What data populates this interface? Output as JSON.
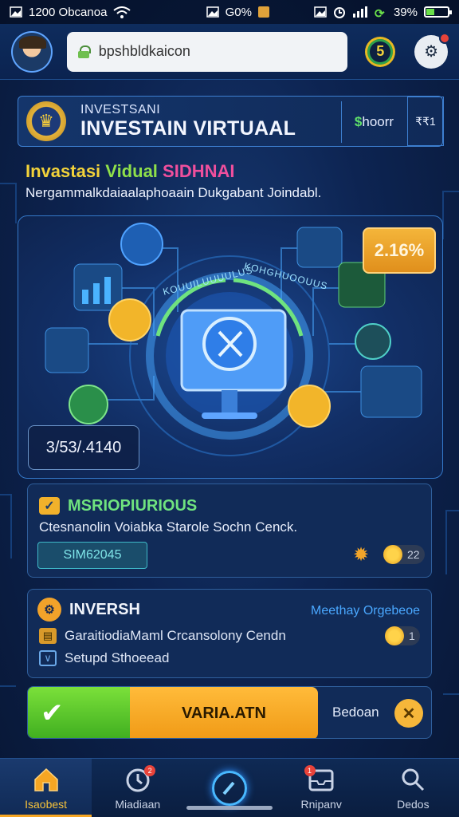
{
  "status_bar": {
    "time": "1200 Obcanoa",
    "battery": "39%",
    "battery_level": 0.39,
    "signal_text": "G0%",
    "icons": [
      "image-icon",
      "wifi-icon",
      "image-icon",
      "alarm-icon",
      "signal-icon",
      "data-icon",
      "battery-icon"
    ]
  },
  "top_bar": {
    "url": "bpshbldkaicon",
    "coin_value": "5",
    "avatar": "avatar-icon"
  },
  "header": {
    "subtitle": "INVESTSANI",
    "title": "INVESTAIN VIRTUAAL",
    "balance_symbol": "$",
    "balance_text": "hoorr",
    "count": "₹₹1"
  },
  "promo": {
    "title_part1": "Invastasi",
    "title_part2": "Vidual",
    "title_part3": "SIDHNAI",
    "description": "Nergammalkdaiaalaphoaain Dukgabant Joindabl."
  },
  "hero": {
    "rate": "2.16%",
    "value": "3/53/.4140",
    "ring_label_left": "KOUUILUUUULUS",
    "ring_label_right": "KOHGHUOOUUS"
  },
  "mission": {
    "title": "MSRIOPIURIOUS",
    "description": "Ctesnanolin Voiabka Starole Sochn Cenck.",
    "code": "SIM62045",
    "pill_value": "22"
  },
  "invest": {
    "title": "INVERSH",
    "link": "Meethay Orgebeoe",
    "row1": "GaraitiodiaMaml Crcansolony Cendn",
    "row2": "Setupd Sthoeead",
    "pill_value": "1"
  },
  "action_bar": {
    "confirm_glyph": "✔",
    "main_label": "VARIA.ATN",
    "side_label": "Bedoan",
    "close_glyph": "✕"
  },
  "bottom_nav": {
    "items": [
      {
        "label": "Isaobest",
        "icon": "home-icon"
      },
      {
        "label": "Miadiaan",
        "icon": "timer-icon",
        "badge": "2"
      },
      {
        "label": "",
        "icon": "edit-icon"
      },
      {
        "label": "Rnipanv",
        "icon": "inbox-icon",
        "badge": "1"
      },
      {
        "label": "Dedos",
        "icon": "search-icon"
      }
    ]
  },
  "colors": {
    "accent_gold": "#f6b73a",
    "accent_green": "#6fe37f",
    "bg_dark": "#0d2452",
    "link_blue": "#4aa8ff"
  }
}
